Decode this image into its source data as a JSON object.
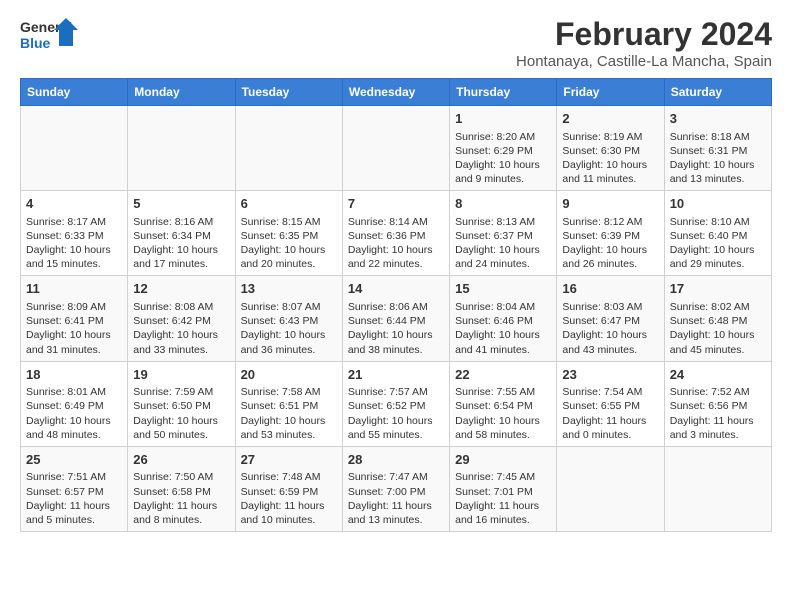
{
  "header": {
    "logo_general": "General",
    "logo_blue": "Blue",
    "main_title": "February 2024",
    "subtitle": "Hontanaya, Castille-La Mancha, Spain"
  },
  "days_of_week": [
    "Sunday",
    "Monday",
    "Tuesday",
    "Wednesday",
    "Thursday",
    "Friday",
    "Saturday"
  ],
  "weeks": [
    [
      {
        "day": "",
        "info": ""
      },
      {
        "day": "",
        "info": ""
      },
      {
        "day": "",
        "info": ""
      },
      {
        "day": "",
        "info": ""
      },
      {
        "day": "1",
        "info": "Sunrise: 8:20 AM\nSunset: 6:29 PM\nDaylight: 10 hours and 9 minutes."
      },
      {
        "day": "2",
        "info": "Sunrise: 8:19 AM\nSunset: 6:30 PM\nDaylight: 10 hours and 11 minutes."
      },
      {
        "day": "3",
        "info": "Sunrise: 8:18 AM\nSunset: 6:31 PM\nDaylight: 10 hours and 13 minutes."
      }
    ],
    [
      {
        "day": "4",
        "info": "Sunrise: 8:17 AM\nSunset: 6:33 PM\nDaylight: 10 hours and 15 minutes."
      },
      {
        "day": "5",
        "info": "Sunrise: 8:16 AM\nSunset: 6:34 PM\nDaylight: 10 hours and 17 minutes."
      },
      {
        "day": "6",
        "info": "Sunrise: 8:15 AM\nSunset: 6:35 PM\nDaylight: 10 hours and 20 minutes."
      },
      {
        "day": "7",
        "info": "Sunrise: 8:14 AM\nSunset: 6:36 PM\nDaylight: 10 hours and 22 minutes."
      },
      {
        "day": "8",
        "info": "Sunrise: 8:13 AM\nSunset: 6:37 PM\nDaylight: 10 hours and 24 minutes."
      },
      {
        "day": "9",
        "info": "Sunrise: 8:12 AM\nSunset: 6:39 PM\nDaylight: 10 hours and 26 minutes."
      },
      {
        "day": "10",
        "info": "Sunrise: 8:10 AM\nSunset: 6:40 PM\nDaylight: 10 hours and 29 minutes."
      }
    ],
    [
      {
        "day": "11",
        "info": "Sunrise: 8:09 AM\nSunset: 6:41 PM\nDaylight: 10 hours and 31 minutes."
      },
      {
        "day": "12",
        "info": "Sunrise: 8:08 AM\nSunset: 6:42 PM\nDaylight: 10 hours and 33 minutes."
      },
      {
        "day": "13",
        "info": "Sunrise: 8:07 AM\nSunset: 6:43 PM\nDaylight: 10 hours and 36 minutes."
      },
      {
        "day": "14",
        "info": "Sunrise: 8:06 AM\nSunset: 6:44 PM\nDaylight: 10 hours and 38 minutes."
      },
      {
        "day": "15",
        "info": "Sunrise: 8:04 AM\nSunset: 6:46 PM\nDaylight: 10 hours and 41 minutes."
      },
      {
        "day": "16",
        "info": "Sunrise: 8:03 AM\nSunset: 6:47 PM\nDaylight: 10 hours and 43 minutes."
      },
      {
        "day": "17",
        "info": "Sunrise: 8:02 AM\nSunset: 6:48 PM\nDaylight: 10 hours and 45 minutes."
      }
    ],
    [
      {
        "day": "18",
        "info": "Sunrise: 8:01 AM\nSunset: 6:49 PM\nDaylight: 10 hours and 48 minutes."
      },
      {
        "day": "19",
        "info": "Sunrise: 7:59 AM\nSunset: 6:50 PM\nDaylight: 10 hours and 50 minutes."
      },
      {
        "day": "20",
        "info": "Sunrise: 7:58 AM\nSunset: 6:51 PM\nDaylight: 10 hours and 53 minutes."
      },
      {
        "day": "21",
        "info": "Sunrise: 7:57 AM\nSunset: 6:52 PM\nDaylight: 10 hours and 55 minutes."
      },
      {
        "day": "22",
        "info": "Sunrise: 7:55 AM\nSunset: 6:54 PM\nDaylight: 10 hours and 58 minutes."
      },
      {
        "day": "23",
        "info": "Sunrise: 7:54 AM\nSunset: 6:55 PM\nDaylight: 11 hours and 0 minutes."
      },
      {
        "day": "24",
        "info": "Sunrise: 7:52 AM\nSunset: 6:56 PM\nDaylight: 11 hours and 3 minutes."
      }
    ],
    [
      {
        "day": "25",
        "info": "Sunrise: 7:51 AM\nSunset: 6:57 PM\nDaylight: 11 hours and 5 minutes."
      },
      {
        "day": "26",
        "info": "Sunrise: 7:50 AM\nSunset: 6:58 PM\nDaylight: 11 hours and 8 minutes."
      },
      {
        "day": "27",
        "info": "Sunrise: 7:48 AM\nSunset: 6:59 PM\nDaylight: 11 hours and 10 minutes."
      },
      {
        "day": "28",
        "info": "Sunrise: 7:47 AM\nSunset: 7:00 PM\nDaylight: 11 hours and 13 minutes."
      },
      {
        "day": "29",
        "info": "Sunrise: 7:45 AM\nSunset: 7:01 PM\nDaylight: 11 hours and 16 minutes."
      },
      {
        "day": "",
        "info": ""
      },
      {
        "day": "",
        "info": ""
      }
    ]
  ]
}
